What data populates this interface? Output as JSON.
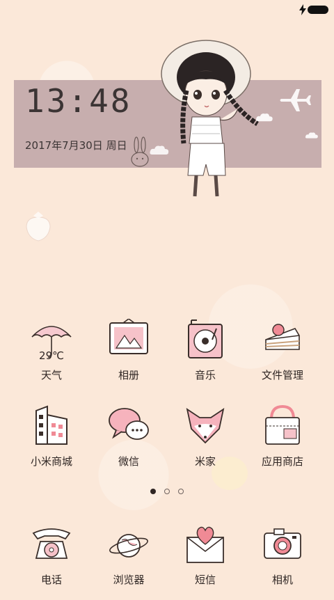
{
  "status_bar": {
    "charging_icon": "bolt-icon",
    "battery_icon": "battery-icon"
  },
  "clock": {
    "time": "13:48",
    "date": "2017年7月30日 周日"
  },
  "widgets": {
    "weather_temp": "29℃"
  },
  "apps": [
    {
      "label": "天气",
      "icon": "umbrella-icon"
    },
    {
      "label": "相册",
      "icon": "picture-frame-icon"
    },
    {
      "label": "音乐",
      "icon": "record-player-icon"
    },
    {
      "label": "文件管理",
      "icon": "cake-icon"
    },
    {
      "label": "小米商城",
      "icon": "building-icon"
    },
    {
      "label": "微信",
      "icon": "chat-bubbles-icon"
    },
    {
      "label": "米家",
      "icon": "fox-icon"
    },
    {
      "label": "应用商店",
      "icon": "shopping-bag-icon"
    }
  ],
  "dock": [
    {
      "label": "电话",
      "icon": "rotary-phone-icon"
    },
    {
      "label": "浏览器",
      "icon": "planet-icon"
    },
    {
      "label": "短信",
      "icon": "envelope-heart-icon"
    },
    {
      "label": "相机",
      "icon": "camera-icon"
    }
  ],
  "page_indicator": {
    "count": 3,
    "active": 1
  },
  "colors": {
    "background": "#fbe8d9",
    "clock_panel": "#c7aeae",
    "accent_pink": "#f2a7b6",
    "ink": "#2f2624"
  }
}
